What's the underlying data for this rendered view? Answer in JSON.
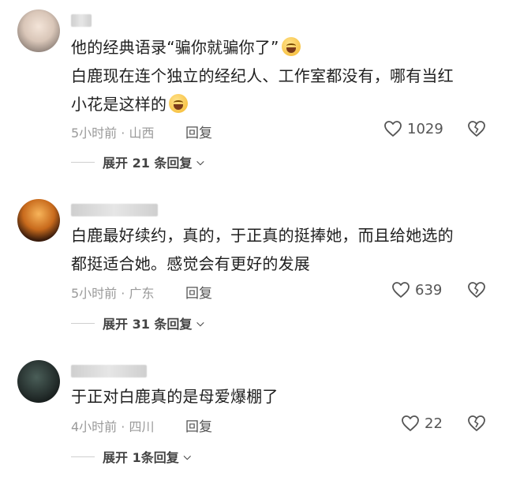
{
  "comments": [
    {
      "lines": [
        "他的经典语录“骗你就骗你了”",
        "白鹿现在连个独立的经纪人、工作室都没有，哪有当红",
        "小花是这样的"
      ],
      "time": "5小时前",
      "location": "山西",
      "reply_label": "回复",
      "likes": "1029",
      "expand_label": "展开 21 条回复"
    },
    {
      "lines": [
        "白鹿最好续约，真的，于正真的挺捧她，而且给她选的",
        "都挺适合她。感觉会有更好的发展"
      ],
      "time": "5小时前",
      "location": "广东",
      "reply_label": "回复",
      "likes": "639",
      "expand_label": "展开 31 条回复"
    },
    {
      "lines": [
        "于正对白鹿真的是母爱爆棚了"
      ],
      "time": "4小时前",
      "location": "四川",
      "reply_label": "回复",
      "likes": "22",
      "expand_label": "展开 1条回复"
    }
  ],
  "separator": "·",
  "icons": {
    "like": "heart-outline-icon",
    "dislike": "broken-heart-icon",
    "expand": "chevron-down-icon"
  }
}
